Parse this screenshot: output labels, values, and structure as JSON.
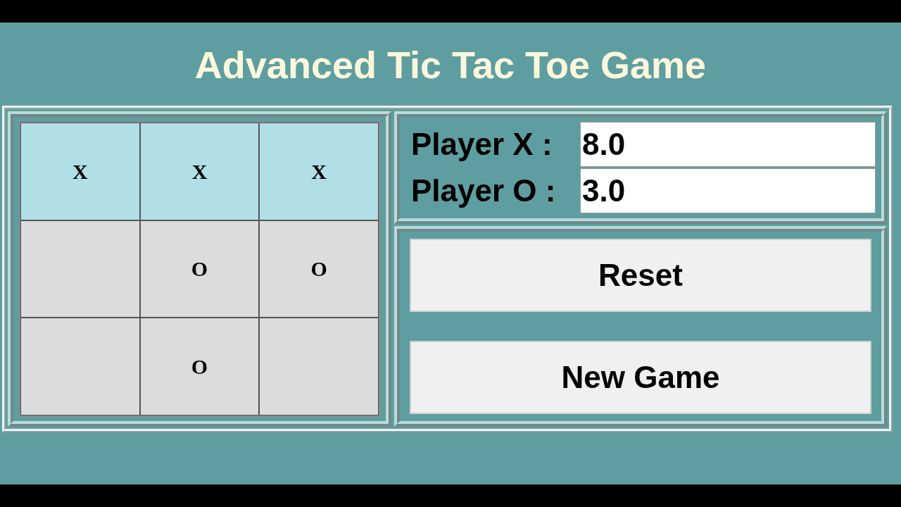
{
  "title": "Advanced Tic Tac Toe Game",
  "board": [
    {
      "mark": "X",
      "highlighted": true
    },
    {
      "mark": "X",
      "highlighted": true
    },
    {
      "mark": "X",
      "highlighted": true
    },
    {
      "highlighted": false
    },
    {
      "mark": "O",
      "highlighted": false
    },
    {
      "mark": "O",
      "highlighted": false
    },
    {
      "highlighted": false
    },
    {
      "mark": "O",
      "highlighted": false
    },
    {
      "highlighted": false
    }
  ],
  "scores": [
    {
      "label": "Player X :",
      "value": "8.0"
    },
    {
      "label": "Player O :",
      "value": "3.0"
    }
  ],
  "buttons": [
    "Reset",
    "New Game"
  ]
}
